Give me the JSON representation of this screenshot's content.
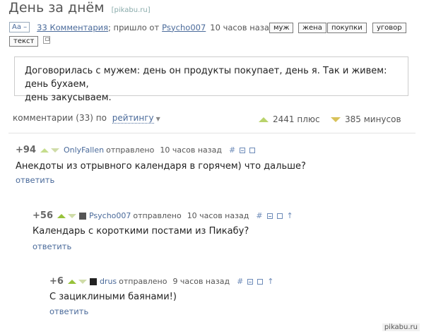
{
  "post": {
    "title": "День за днём",
    "source": "[pikabu.ru]",
    "font_button": "Aa –",
    "comments_link": "33 Комментария",
    "from_text": "; пришло от",
    "author": "Psycho007",
    "time": "10 часов назад",
    "tags": [
      "муж",
      "жена",
      "покупки",
      "уговор",
      "текст"
    ],
    "text_line1": "Договорилась с мужем: день он продукты покупает, день я. Так и живем: день бухаем,",
    "text_line2": "день закусываем."
  },
  "comments_bar": {
    "label": "комментарии (33) по",
    "sort": "рейтингу",
    "plus_count": "2441 плюс",
    "minus_count": "385 минусов"
  },
  "comments": [
    {
      "rating": "+94",
      "author": "OnlyFallen",
      "sent": "отправлено",
      "time": "10 часов назад",
      "text": "Анекдоты из отрывного календаря в горячем) что дальше?",
      "reply": "ответить"
    },
    {
      "rating": "+56",
      "author": "Psycho007",
      "sent": "отправлено",
      "time": "10 часов назад",
      "text": "Календарь с короткими постами из Пикабу?",
      "reply": "ответить"
    },
    {
      "rating": "+6",
      "author": "drus",
      "sent": "отправлено",
      "time": "9 часов назад",
      "text": "С зациклиными баянами!)",
      "reply": "ответить"
    }
  ],
  "icons": {
    "hash": "#",
    "arrow": "↑"
  },
  "watermark": "pikabu.ru",
  "colors": {
    "link": "#4a6a9a",
    "plus": "#b9d36c",
    "minus": "#d8c25a"
  }
}
